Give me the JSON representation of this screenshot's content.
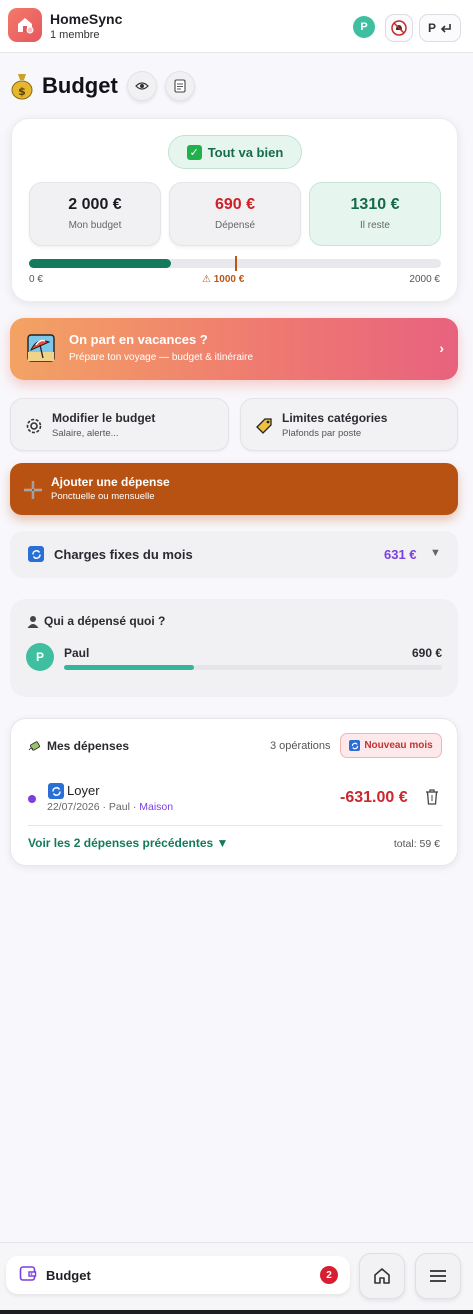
{
  "header": {
    "app_name": "HomeSync",
    "member_count": "1 membre",
    "avatar_initial": "P",
    "user_switch_initial": "P",
    "user_switch_icon": "arrow-return-icon"
  },
  "page": {
    "title": "Budget",
    "icon": "money-bag-icon",
    "actions": [
      "eye-icon",
      "document-icon"
    ]
  },
  "summary": {
    "status": "Tout va bien",
    "stats": [
      {
        "value": "2 000 €",
        "label": "Mon budget",
        "color": "#1b1b22"
      },
      {
        "value": "690 €",
        "label": "Dépensé",
        "color": "#cf1f27"
      },
      {
        "value": "1310 €",
        "label": "Il reste",
        "color": "#14694e"
      }
    ],
    "progress": {
      "spent": 690,
      "budget": 2000,
      "alert": 1000
    },
    "scale_min": "0 €",
    "scale_alert": "⚠ 1000 €",
    "scale_max": "2000 €"
  },
  "vacation": {
    "title": "On part en vacances ?",
    "subtitle": "Prépare ton voyage — budget & itinéraire",
    "chevron": "›"
  },
  "actions": {
    "edit_budget": {
      "title": "Modifier le budget",
      "subtitle": "Salaire, alerte..."
    },
    "category_limits": {
      "title": "Limites catégories",
      "subtitle": "Plafonds par poste"
    },
    "add_expense": {
      "title": "Ajouter une dépense",
      "subtitle": "Ponctuelle ou mensuelle"
    }
  },
  "charges": {
    "label": "Charges fixes du mois",
    "amount": "631 €",
    "caret": "▼"
  },
  "who_spent": {
    "title": "Qui a dépensé quoi ?",
    "people": [
      {
        "initial": "P",
        "name": "Paul",
        "amount": "690 €",
        "share": 0.345
      }
    ]
  },
  "expenses": {
    "title": "Mes dépenses",
    "operations": "3 opérations",
    "new_month": "Nouveau mois",
    "items": [
      {
        "name": "Loyer",
        "date": "22/07/2026",
        "person": "Paul",
        "category": "Maison",
        "amount": "-631.00 €"
      }
    ],
    "meta_sep": "·",
    "previous_link": "Voir les 2 dépenses précédentes ▼",
    "total": "total: 59 €"
  },
  "bottom_nav": {
    "tab_label": "Budget",
    "badge": "2",
    "buttons": [
      "home-icon",
      "menu-icon"
    ]
  },
  "colors": {
    "accent_green": "#127a5d",
    "alert_orange": "#b9571b",
    "expense_red": "#c8282e",
    "purple": "#7b3fe0",
    "add_button": "#b75213"
  }
}
